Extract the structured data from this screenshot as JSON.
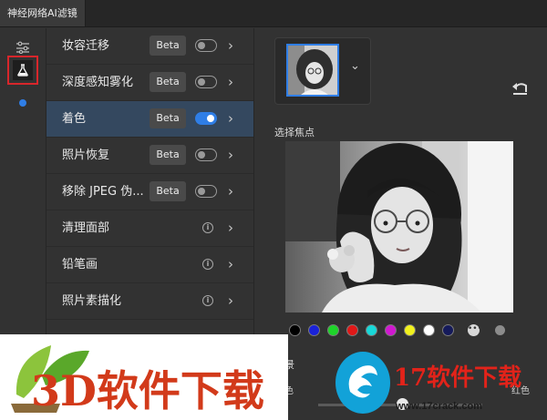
{
  "tab": {
    "title": "神经网络AI滤镜"
  },
  "rail": {
    "items": [
      {
        "name": "sliders-icon",
        "glyph": "⚟"
      },
      {
        "name": "flask-icon",
        "glyph": "⚗"
      }
    ],
    "active_color": "#d8262b",
    "indicator_color": "#2f7ee6"
  },
  "filters": [
    {
      "label": "妆容迁移",
      "badge": "Beta",
      "control": "toggle",
      "on": false
    },
    {
      "label": "深度感知雾化",
      "badge": "Beta",
      "control": "toggle",
      "on": false
    },
    {
      "label": "着色",
      "badge": "Beta",
      "control": "toggle",
      "on": true,
      "active": true
    },
    {
      "label": "照片恢复",
      "badge": "Beta",
      "control": "toggle",
      "on": false
    },
    {
      "label": "移除 JPEG 伪...",
      "badge": "Beta",
      "control": "toggle",
      "on": false
    },
    {
      "label": "清理面部",
      "control": "info"
    },
    {
      "label": "铅笔画",
      "control": "info"
    },
    {
      "label": "照片素描化",
      "control": "info"
    }
  ],
  "panel": {
    "focus_label": "选择焦点",
    "color_swatches": [
      "#000000",
      "#1a22d8",
      "#1ed42a",
      "#e01818",
      "#18d8d8",
      "#d018d0",
      "#f2f21e",
      "#ffffff",
      "#151a5a"
    ],
    "background_label": "景",
    "left_label": "色",
    "right_label": "红色"
  },
  "watermark": {
    "left_text": "3D软件下载",
    "right_main": "17软件下载",
    "right_url": "www.17crack.com"
  }
}
